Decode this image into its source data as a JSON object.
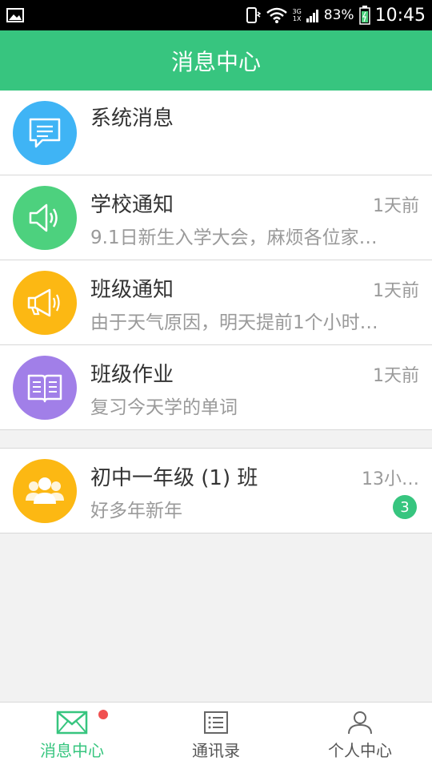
{
  "status_bar": {
    "battery": "83%",
    "time": "10:45",
    "network_3g": "3G",
    "network_1x": "1X"
  },
  "header": {
    "title": "消息中心"
  },
  "messages": [
    {
      "name": "系统消息",
      "time": "",
      "preview": "",
      "icon": "chat-bubble-icon",
      "color": "#3fb4f5"
    },
    {
      "name": "学校通知",
      "time": "1天前",
      "preview": "9.1日新生入学大会，麻烦各位家…",
      "icon": "speaker-icon",
      "color": "#4dd17e"
    },
    {
      "name": "班级通知",
      "time": "1天前",
      "preview": "由于天气原因，明天提前1个小时…",
      "icon": "megaphone-icon",
      "color": "#fcb813"
    },
    {
      "name": "班级作业",
      "time": "1天前",
      "preview": "复习今天学的单词",
      "icon": "book-icon",
      "color": "#a17fe8"
    }
  ],
  "group": {
    "name": "初中一年级 (1) 班",
    "time": "13小…",
    "preview": "好多年新年",
    "badge": "3",
    "icon": "group-icon",
    "color": "#fcb813"
  },
  "tabs": [
    {
      "label": "消息中心",
      "icon": "envelope-icon",
      "active": true,
      "has_dot": true
    },
    {
      "label": "通讯录",
      "icon": "contacts-list-icon",
      "active": false
    },
    {
      "label": "个人中心",
      "icon": "person-icon",
      "active": false
    }
  ],
  "colors": {
    "accent": "#37c57f",
    "badge_dot": "#f05050"
  }
}
